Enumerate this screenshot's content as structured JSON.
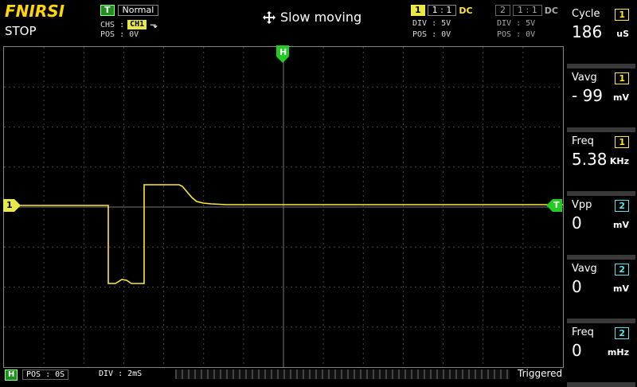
{
  "header": {
    "brand": "FNIRSI",
    "state": "STOP",
    "trigger_badge": "T",
    "trigger_mode": "Normal",
    "chs_label": "CHS :",
    "chs_value": "CH1",
    "edge_symbol": "⹂",
    "pos_label": "POS : 0V",
    "center_title": "Slow moving",
    "move_icon": "move-arrows-icon",
    "ch1": {
      "num": "1",
      "probe": "1 : 1",
      "coupling": "DC",
      "div": "DIV :  5V",
      "pos": "POS : 0V"
    },
    "ch2": {
      "num": "2",
      "probe": "1 : 1",
      "coupling": "DC",
      "div": "DIV :  5V",
      "pos": "POS : 0V"
    }
  },
  "screen": {
    "h_marker": "H",
    "ch1_marker": "1",
    "trig_marker": "T"
  },
  "measurements": [
    {
      "label": "Cycle",
      "channel": "1",
      "value": "186",
      "unit": "uS",
      "color": "yellow"
    },
    {
      "label": "Vavg",
      "channel": "1",
      "value": "-  99",
      "unit": "mV",
      "color": "yellow"
    },
    {
      "label": "Freq",
      "channel": "1",
      "value": "5.38",
      "unit": "KHz",
      "color": "yellow"
    },
    {
      "label": "Vpp",
      "channel": "2",
      "value": "0",
      "unit": "mV",
      "color": "cyan"
    },
    {
      "label": "Vavg",
      "channel": "2",
      "value": "0",
      "unit": "mV",
      "color": "cyan"
    },
    {
      "label": "Freq",
      "channel": "2",
      "value": "0",
      "unit": "mHz",
      "color": "cyan"
    }
  ],
  "footer": {
    "h_badge": "H",
    "pos": "POS : 0S",
    "div": "DIV : 2mS",
    "status": "Triggered"
  },
  "colors": {
    "ch1": "#ffe838",
    "ch2": "#5ce1ea",
    "trigger": "#22cc22",
    "grid": "#555555"
  }
}
